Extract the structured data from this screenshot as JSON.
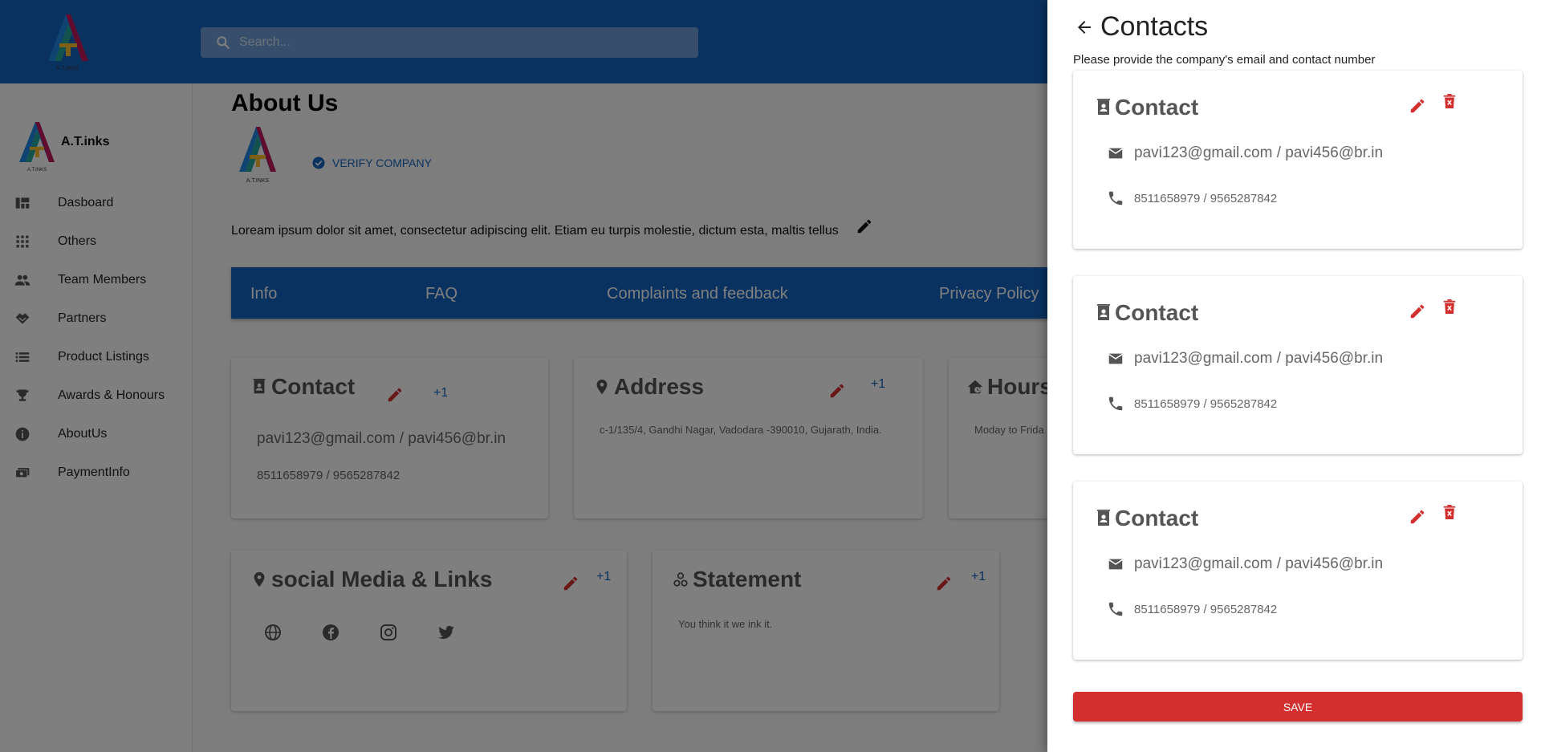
{
  "header": {
    "logo_text": "A.T.INKS",
    "search_placeholder": "Search..."
  },
  "sidebar": {
    "brand_name": "A.T.inks",
    "brand_logo_text": "A.T.INKS",
    "items": [
      {
        "label": "Dasboard",
        "icon": "dashboard-icon"
      },
      {
        "label": "Others",
        "icon": "apps-grid-icon"
      },
      {
        "label": "Team Members",
        "icon": "people-icon"
      },
      {
        "label": "Partners",
        "icon": "handshake-icon"
      },
      {
        "label": "Product Listings",
        "icon": "list-icon"
      },
      {
        "label": "Awards & Honours",
        "icon": "trophy-icon"
      },
      {
        "label": "AboutUs",
        "icon": "info-icon"
      },
      {
        "label": "PaymentInfo",
        "icon": "payments-icon"
      }
    ]
  },
  "main": {
    "title": "About Us",
    "company_logo_text": "A.T.INKS",
    "verify_label": "VERIFY COMPANY",
    "about_text": "Loream ipsum dolor sit amet, consectetur adipiscing elit. Etiam eu turpis molestie, dictum esta, maltis tellus",
    "tabs": [
      "Info",
      "FAQ",
      "Complaints and feedback",
      "Privacy Policy"
    ],
    "cards": {
      "contact": {
        "title": "Contact",
        "plus": "+1",
        "email": "pavi123@gmail.com / pavi456@br.in",
        "phone": "8511658979 / 9565287842"
      },
      "address": {
        "title": "Address",
        "plus": "+1",
        "text": "c-1/135/4, Gandhi Nagar, Vadodara -390010, Gujarath, India."
      },
      "hours": {
        "title": "Hours",
        "text": "Moday to Frida"
      },
      "social": {
        "title": "social Media & Links",
        "plus": "+1"
      },
      "statement": {
        "title": "Statement",
        "plus": "+1",
        "text": "You think it we ink it."
      }
    }
  },
  "drawer": {
    "title": "Contacts",
    "subtitle": "Please provide the company's email and contact number",
    "contacts": [
      {
        "title": "Contact",
        "email": "pavi123@gmail.com / pavi456@br.in",
        "phone": "8511658979 / 9565287842"
      },
      {
        "title": "Contact",
        "email": "pavi123@gmail.com / pavi456@br.in",
        "phone": "8511658979 / 9565287842"
      },
      {
        "title": "Contact",
        "email": "pavi123@gmail.com / pavi456@br.in",
        "phone": "8511658979 / 9565287842"
      }
    ],
    "save_label": "SAVE"
  },
  "colors": {
    "primary": "#1565c0",
    "danger": "#d32f2f",
    "overlay": "rgba(0,0,0,0.5)"
  }
}
